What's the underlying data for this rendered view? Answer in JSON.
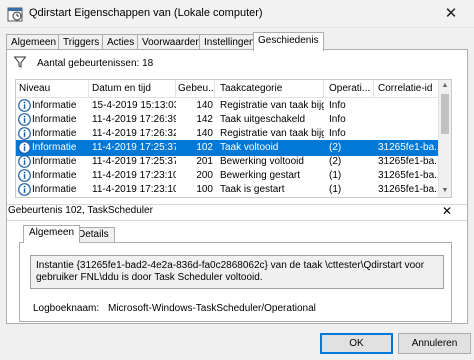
{
  "window": {
    "title": "Qdirstart Eigenschappen van (Lokale computer)",
    "close_glyph": "✕"
  },
  "tabs": [
    {
      "label": "Algemeen"
    },
    {
      "label": "Triggers"
    },
    {
      "label": "Acties"
    },
    {
      "label": "Voorwaarden"
    },
    {
      "label": "Instellingen"
    },
    {
      "label": "Geschiedenis",
      "active": true
    }
  ],
  "history": {
    "event_count_label": "Aantal gebeurtenissen: 18",
    "columns": [
      "Niveau",
      "Datum en tijd",
      "Gebeu...",
      "Taakcategorie",
      "Operati...",
      "Correlatie-id"
    ],
    "rows": [
      {
        "level": "Informatie",
        "datetime": "15-4-2019 15:13:03",
        "event_id": "140",
        "category": "Registratie van taak bijg...",
        "opcode": "Info",
        "correlation": ""
      },
      {
        "level": "Informatie",
        "datetime": "11-4-2019 17:26:39",
        "event_id": "142",
        "category": "Taak uitgeschakeld",
        "opcode": "Info",
        "correlation": ""
      },
      {
        "level": "Informatie",
        "datetime": "11-4-2019 17:26:32",
        "event_id": "140",
        "category": "Registratie van taak bijg...",
        "opcode": "Info",
        "correlation": ""
      },
      {
        "level": "Informatie",
        "datetime": "11-4-2019 17:25:37",
        "event_id": "102",
        "category": "Taak voltooid",
        "opcode": "(2)",
        "correlation": "31265fe1-ba...",
        "selected": true
      },
      {
        "level": "Informatie",
        "datetime": "11-4-2019 17:25:37",
        "event_id": "201",
        "category": "Bewerking voltooid",
        "opcode": "(2)",
        "correlation": "31265fe1-ba..."
      },
      {
        "level": "Informatie",
        "datetime": "11-4-2019 17:23:10",
        "event_id": "200",
        "category": "Bewerking gestart",
        "opcode": "(1)",
        "correlation": "31265fe1-ba..."
      },
      {
        "level": "Informatie",
        "datetime": "11-4-2019 17:23:10",
        "event_id": "100",
        "category": "Taak is gestart",
        "opcode": "(1)",
        "correlation": "31265fe1-ba..."
      }
    ]
  },
  "detail": {
    "title": "Gebeurtenis 102, TaskScheduler",
    "close_glyph": "✕",
    "tabs": [
      {
        "label": "Algemeen",
        "active": true
      },
      {
        "label": "Details"
      }
    ],
    "description": "Instantie {31265fe1-bad2-4e2a-836d-fa0c2868062c} van de taak \\cttester\\Qdirstart voor gebruiker FNL\\ddu is door Task Scheduler voltooid.",
    "log_name_label": "Logboeknaam:",
    "log_name_value": "Microsoft-Windows-TaskScheduler/Operational"
  },
  "buttons": {
    "ok": "OK",
    "cancel": "Annuleren"
  },
  "colors": {
    "selection": "#0078d7",
    "info_icon": "#1f5fa8"
  }
}
